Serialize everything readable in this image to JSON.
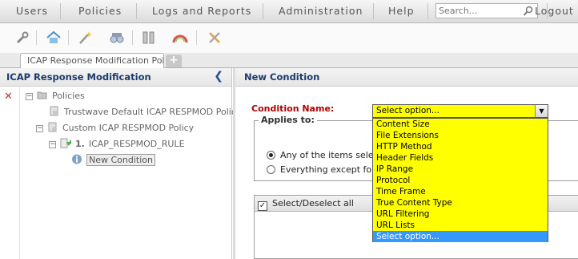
{
  "menu": {
    "items": [
      "Users",
      "Policies",
      "Logs and Reports",
      "Administration",
      "Help"
    ],
    "logout": "Logout",
    "search_placeholder": "Search..."
  },
  "toolbar": {
    "icons": [
      "wrench-icon",
      "home-icon",
      "wand-icon",
      "binoculars-icon",
      "books-icon",
      "gauge-icon",
      "tools-icon"
    ]
  },
  "tabs": {
    "active": "ICAP Response Modification Pol",
    "add": "+"
  },
  "left_pane": {
    "title": "ICAP Response Modification",
    "tree": {
      "root": "Policies",
      "default_policy": "Trustwave Default ICAP RESPMOD Policy",
      "custom_policy": "Custom ICAP RESPMOD Policy",
      "rule_number": "1.",
      "rule": "ICAP_RESPMOD_RULE",
      "selected": "New Condition"
    }
  },
  "right_pane": {
    "title": "New Condition",
    "condition_name_label": "Condition Name:",
    "applies_to": "Applies to:",
    "radio_any": "Any of the items selecte",
    "radio_except": "Everything except for th",
    "select_all": "Select/Deselect all"
  },
  "dropdown": {
    "selected": "Select option...",
    "options": [
      "Content Size",
      "File Extensions",
      "HTTP Method",
      "Header Fields",
      "IP Range",
      "Protocol",
      "Time Frame",
      "True Content Type",
      "URL Filtering",
      "URL Lists",
      "Select option..."
    ],
    "highlighted_index": 10,
    "color": "#ffff00",
    "highlight_color": "#3399ff"
  }
}
